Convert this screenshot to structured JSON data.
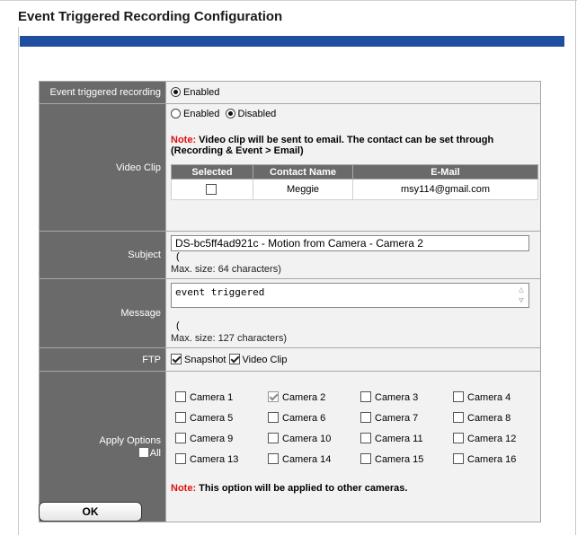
{
  "page": {
    "title": "Event Triggered Recording Configuration"
  },
  "event_recording": {
    "label": "Event triggered recording",
    "option": "Enabled",
    "selected": true
  },
  "video_clip": {
    "label": "Video Clip",
    "options": [
      {
        "label": "Enabled",
        "selected": false
      },
      {
        "label": "Disabled",
        "selected": true
      }
    ],
    "note_prefix": "Note:",
    "note_text": " Video clip will be sent to email. The contact can be set through (Recording & Event > Email)",
    "table": {
      "headers": [
        "Selected",
        "Contact Name",
        "E-Mail"
      ],
      "rows": [
        {
          "selected": false,
          "name": "Meggie",
          "email": "msy114@gmail.com"
        }
      ]
    }
  },
  "subject": {
    "label": "Subject",
    "value": "DS-bc5ff4ad921c - Motion from Camera - Camera 2",
    "hint": "Max. size: 64 characters)",
    "paren": "("
  },
  "message": {
    "label": "Message",
    "value": "event triggered",
    "hint": "Max. size: 127 characters)",
    "paren": "("
  },
  "ftp": {
    "label": "FTP",
    "snapshot": "Snapshot",
    "video_clip": "Video Clip"
  },
  "apply_options": {
    "label": "Apply Options",
    "all_label": "All",
    "cameras": [
      {
        "label": "Camera 1",
        "checked": false
      },
      {
        "label": "Camera 2",
        "checked": true
      },
      {
        "label": "Camera 3",
        "checked": false
      },
      {
        "label": "Camera 4",
        "checked": false
      },
      {
        "label": "Camera 5",
        "checked": false
      },
      {
        "label": "Camera 6",
        "checked": false
      },
      {
        "label": "Camera 7",
        "checked": false
      },
      {
        "label": "Camera 8",
        "checked": false
      },
      {
        "label": "Camera 9",
        "checked": false
      },
      {
        "label": "Camera 10",
        "checked": false
      },
      {
        "label": "Camera 11",
        "checked": false
      },
      {
        "label": "Camera 12",
        "checked": false
      },
      {
        "label": "Camera 13",
        "checked": false
      },
      {
        "label": "Camera 14",
        "checked": false
      },
      {
        "label": "Camera 15",
        "checked": false
      },
      {
        "label": "Camera 16",
        "checked": false
      }
    ],
    "note_prefix": "Note:",
    "note_text": " This option will be applied to other cameras."
  },
  "ok_button": {
    "label": "OK"
  },
  "colors": {
    "title_bar": "#1f4f9e",
    "label_bg": "#6a6a6a",
    "note_red": "#e01010"
  }
}
